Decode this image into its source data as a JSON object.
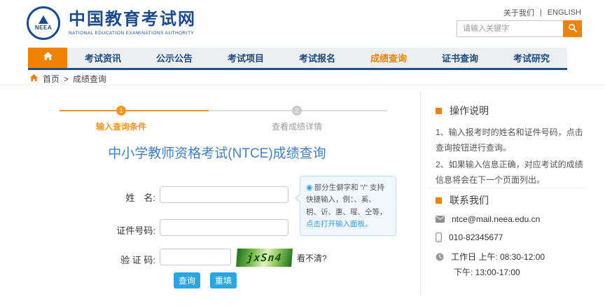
{
  "colors": {
    "brand_navy": "#1B4A8F",
    "accent_orange": "#F08200",
    "title_blue": "#4080C4",
    "button_blue": "#2BA6E0",
    "step_orange": "#F7941E"
  },
  "header": {
    "logo_acronym": "NEEA",
    "site_name": "中国教育考试网",
    "site_subtitle": "NATIONAL EDUCATION EXAMINATIONS AUTHORITY",
    "about_link": "关于我们",
    "links_divider": "|",
    "english_link": "ENGLISH",
    "search_placeholder": "请输入关键字"
  },
  "nav": {
    "items": [
      {
        "label": "考试资讯"
      },
      {
        "label": "公示公告"
      },
      {
        "label": "考试项目"
      },
      {
        "label": "考试报名"
      },
      {
        "label": "成绩查询"
      },
      {
        "label": "证书查询"
      },
      {
        "label": "考试研究"
      }
    ]
  },
  "breadcrumb": {
    "home": "首页",
    "separator": ">",
    "current": "成绩查询"
  },
  "steps": {
    "step1_number": "1",
    "step1_label": "输入查询条件",
    "step2_number": "2",
    "step2_label": "查看成绩详情"
  },
  "main": {
    "title": "中小学教师资格考试(NTCE)成绩查询",
    "form": {
      "name_label": "姓　名:",
      "id_label": "证件号码:",
      "captcha_label": "验 证 码:",
      "captcha_text": "jxSn4",
      "captcha_refresh_link": "看不清?",
      "query_button": "查询",
      "reset_button": "重填"
    },
    "tooltip": {
      "radio_icon": "◉",
      "body": "部分生僻字和 \"/\" 支持快捷输入，例：、奚、枂、䜣、惠、瑆、仝等，",
      "link": "点击打开输入面板。"
    }
  },
  "sidebar": {
    "instructions_title": "操作说明",
    "instruction_1": "1、输入报考时的姓名和证件号码，点击查询按钮进行查询。",
    "instruction_2": "2、如果输入信息正确，对应考试的成绩信息将会在下一个页面列出。",
    "contact_title": "联系我们",
    "email": "ntce@mail.neea.edu.cn",
    "phone": "010-82345677",
    "hours_line1": "工作日 上午: 08:30-12:00",
    "hours_line2": "下午: 13:00-17:00"
  }
}
